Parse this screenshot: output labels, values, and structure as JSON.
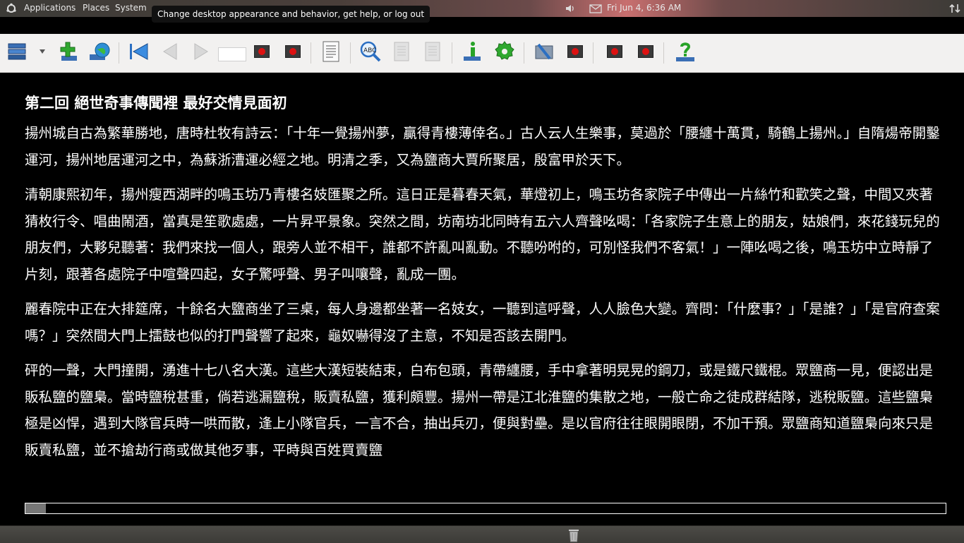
{
  "top_panel": {
    "menus": [
      "Applications",
      "Places",
      "System"
    ],
    "tooltip": "Change desktop appearance and behavior, get help, or log out",
    "clock": "Fri Jun  4,  6:36 AM",
    "icons": [
      "volume-icon",
      "mail-icon",
      "network-icon"
    ]
  },
  "toolbar": {
    "page_value": "",
    "icons": [
      "library-icon",
      "add-book-icon",
      "globe-icon",
      "first-page-icon",
      "back-icon",
      "forward-icon",
      "stop-icon",
      "stop-icon",
      "document-icon",
      "search-text-icon",
      "page-icon",
      "page-icon",
      "info-icon",
      "settings-icon",
      "tools-icon",
      "stop-icon",
      "stop-icon",
      "stop-icon",
      "help-icon"
    ]
  },
  "document": {
    "title": "第二回 絕世奇事傳聞裡 最好交情見面初",
    "paragraphs": [
      "揚州城自古為繁華勝地，唐時杜牧有詩云：「十年一覺揚州夢，贏得青樓薄倖名。」古人云人生樂事，莫過於「腰纏十萬貫，騎鶴上揚州。」自隋煬帝開鑿運河，揚州地居運河之中，為蘇浙漕運必經之地。明清之季，又為鹽商大賈所聚居，殷富甲於天下。",
      "清朝康熙初年，揚州瘦西湖畔的鳴玉坊乃青樓名妓匯聚之所。這日正是暮春天氣，華燈初上，鳴玉坊各家院子中傳出一片絲竹和歡笑之聲，中間又夾著猜枚行令、唱曲鬧酒，當真是笙歌處處，一片昇平景象。突然之間，坊南坊北同時有五六人齊聲吆喝：「各家院子生意上的朋友，姑娘們，來花錢玩兒的朋友們，大夥兒聽著：我們來找一個人，跟旁人並不相干，誰都不許亂叫亂動。不聽吩咐的，可別怪我們不客氣！」一陣吆喝之後，鳴玉坊中立時靜了片刻，跟著各處院子中喧聲四起，女子驚呼聲、男子叫嚷聲，亂成一團。",
      "麗春院中正在大排筵席，十餘名大鹽商坐了三桌，每人身邊都坐著一名妓女，一聽到這呼聲，人人臉色大變。齊問：「什麼事？」「是誰？」「是官府查案嗎？」突然間大門上擂鼓也似的打門聲響了起來，龜奴嚇得沒了主意，不知是否該去開門。",
      "砰的一聲，大門撞開，湧進十七八名大漢。這些大漢短裝結束，白布包頭，青帶纏腰，手中拿著明晃晃的鋼刀，或是鐵尺鐵棍。眾鹽商一見，便認出是販私鹽的鹽梟。當時鹽稅甚重，倘若逃漏鹽稅，販賣私鹽，獲利頗豐。揚州一帶是江北淮鹽的集散之地，一般亡命之徒成群結隊，逃稅販鹽。這些鹽梟極是凶悍，遇到大隊官兵時一哄而散，逢上小隊官兵，一言不合，抽出兵刃，便與對壘。是以官府往往眼開眼閉，不加干預。眾鹽商知道鹽梟向來只是販賣私鹽，並不搶劫行商或做其他歹事，平時與百姓買賣鹽"
    ]
  },
  "progress": {
    "fraction": 0.022
  },
  "bottom_panel": {
    "icons": [
      "trash-icon"
    ]
  },
  "colors": {
    "background": "#000000",
    "text": "#ffffff",
    "toolbar": "#f2f1f0"
  }
}
